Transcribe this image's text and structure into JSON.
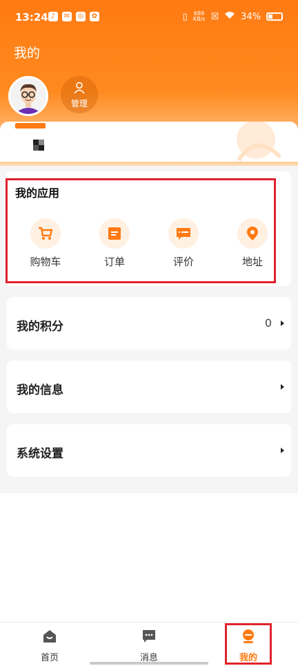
{
  "status_bar": {
    "time": "13:24",
    "net_speed_value": "689",
    "net_speed_unit": "KB/s",
    "battery": "34%"
  },
  "header": {
    "title": "我的",
    "manage_label": "管理"
  },
  "apps": {
    "title": "我的应用",
    "items": [
      {
        "label": "购物车",
        "icon": "cart-icon"
      },
      {
        "label": "订单",
        "icon": "order-icon"
      },
      {
        "label": "评价",
        "icon": "review-icon"
      },
      {
        "label": "地址",
        "icon": "location-icon"
      }
    ]
  },
  "menus": [
    {
      "label": "我的积分",
      "value": "0"
    },
    {
      "label": "我的信息",
      "value": ""
    },
    {
      "label": "系统设置",
      "value": ""
    }
  ],
  "tabbar": {
    "items": [
      {
        "label": "首页",
        "icon": "home-icon",
        "active": false
      },
      {
        "label": "消息",
        "icon": "message-icon",
        "active": false
      },
      {
        "label": "我的",
        "icon": "profile-icon",
        "active": true
      }
    ]
  },
  "colors": {
    "accent": "#ff7a12",
    "highlight": "#e0222c",
    "background": "#f5f5f6"
  }
}
